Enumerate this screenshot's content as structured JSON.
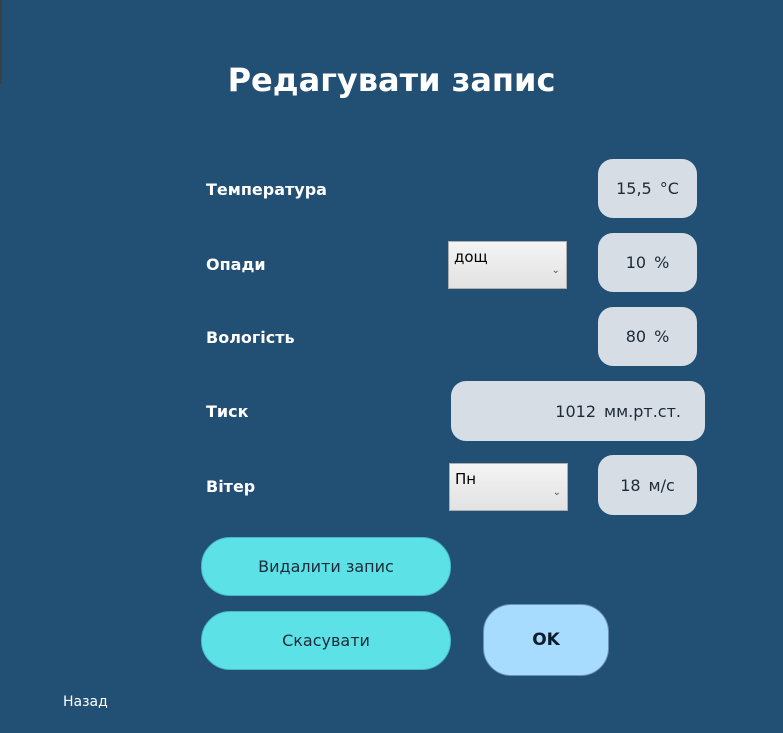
{
  "title": "Редагувати запис",
  "fields": {
    "temperature": {
      "label": "Температура",
      "value": "15,5",
      "unit": "°C"
    },
    "precipitation": {
      "label": "Опади",
      "type": "дощ",
      "value": "10",
      "unit": "%"
    },
    "humidity": {
      "label": "Вологість",
      "value": "80",
      "unit": "%"
    },
    "pressure": {
      "label": "Тиск",
      "value": "1012",
      "unit": "мм.рт.ст."
    },
    "wind": {
      "label": "Вітер",
      "direction": "Пн",
      "value": "18",
      "unit": "м/с"
    }
  },
  "buttons": {
    "delete": "Видалити запис",
    "cancel": "Скасувати",
    "ok": "OK",
    "back": "Назад"
  },
  "colors": {
    "background": "#224f74",
    "value_box": "#d6dde5",
    "cyan_button": "#5ce1e6",
    "ok_button": "#a8dcff"
  },
  "icons": {
    "dropdown": "chevron-down-icon"
  }
}
